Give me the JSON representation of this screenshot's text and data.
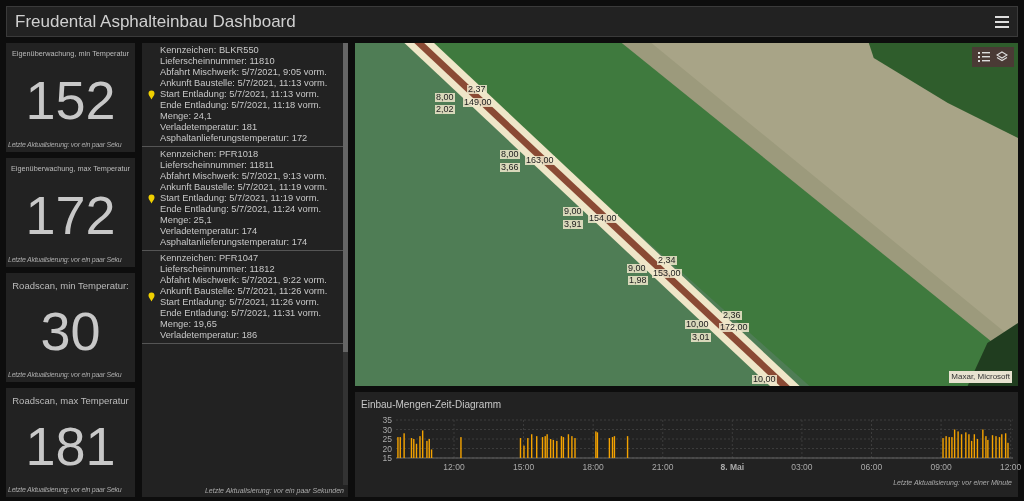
{
  "header": {
    "title": "Freudental Asphalteinbau Dashboard"
  },
  "indicators": [
    {
      "title": "Eigenüberwachung, min Temperatur",
      "value": "152",
      "footer": "Letzte Aktualisierung: vor ein paar Seku"
    },
    {
      "title": "Eigenüberwachung, max Temperatur",
      "value": "172",
      "footer": "Letzte Aktualisierung: vor ein paar Seku"
    },
    {
      "title": "Roadscan, min Temperatur:",
      "value": "30",
      "footer": "Letzte Aktualisierung: vor ein paar Seku"
    },
    {
      "title": "Roadscan, max Temperatur",
      "value": "181",
      "footer": "Letzte Aktualisierung: vor ein paar Seku"
    }
  ],
  "deliveries": {
    "items": [
      {
        "lines": [
          "Kennzeichen: BLKR550",
          "Lieferscheinnummer: 11810",
          "Abfahrt Mischwerk: 5/7/2021, 9:05 vorm.",
          "Ankunft Baustelle: 5/7/2021, 11:13 vorm.",
          "Start Entladung: 5/7/2021, 11:13 vorm.",
          "Ende Entladung: 5/7/2021, 11:18 vorm.",
          "Menge: 24,1",
          "Verladetemperatur: 181",
          "Asphaltanlieferungstemperatur: 172"
        ]
      },
      {
        "lines": [
          "Kennzeichen: PFR1018",
          "Lieferscheinnummer: 11811",
          "Abfahrt Mischwerk: 5/7/2021, 9:13 vorm.",
          "Ankunft Baustelle: 5/7/2021, 11:19 vorm.",
          "Start Entladung: 5/7/2021, 11:19 vorm.",
          "Ende Entladung: 5/7/2021, 11:24 vorm.",
          "Menge: 25,1",
          "Verladetemperatur: 174",
          "Asphaltanlieferungstemperatur: 174"
        ]
      },
      {
        "lines": [
          "Kennzeichen: PFR1047",
          "Lieferscheinnummer: 11812",
          "Abfahrt Mischwerk: 5/7/2021, 9:22 vorm.",
          "Ankunft Baustelle: 5/7/2021, 11:26 vorm.",
          "Start Entladung: 5/7/2021, 11:26 vorm.",
          "Ende Entladung: 5/7/2021, 11:31 vorm.",
          "Menge: 19,65",
          "Verladetemperatur: 186"
        ]
      }
    ],
    "footer": "Letzte Aktualisierung: vor ein paar Sekunden"
  },
  "map": {
    "labels": [
      "2,37",
      "8,00",
      "149,00",
      "2,02",
      "8,00",
      "163,00",
      "3,66",
      "9,00",
      "154,00",
      "3,91",
      "2,34",
      "9,00",
      "153,00",
      "1,98",
      "2,36",
      "10,00",
      "172,00",
      "3,01",
      "10,00"
    ],
    "attribution": "Maxar, Microsoft"
  },
  "chart": {
    "title": "Einbau-Mengen-Zeit-Diagramm",
    "footer": "Letzte Aktualisierung: vor einer Minute",
    "chart_data": {
      "type": "bar",
      "grid": true,
      "xlim": [
        "2021-05-07T09:30",
        "2021-05-08T12:06"
      ],
      "ylim": [
        15,
        35
      ],
      "yticks": [
        15,
        20,
        25,
        30,
        35
      ],
      "xticks": [
        {
          "value": "2021-05-07T12:00",
          "label": "12:00"
        },
        {
          "value": "2021-05-07T15:00",
          "label": "15:00"
        },
        {
          "value": "2021-05-07T18:00",
          "label": "18:00"
        },
        {
          "value": "2021-05-07T21:00",
          "label": "21:00"
        },
        {
          "value": "2021-05-08T00:00",
          "label": "8. Mai"
        },
        {
          "value": "2021-05-08T03:00",
          "label": "03:00"
        },
        {
          "value": "2021-05-08T06:00",
          "label": "06:00"
        },
        {
          "value": "2021-05-08T09:00",
          "label": "09:00"
        },
        {
          "value": "2021-05-08T12:00",
          "label": "12:00"
        }
      ],
      "x": [
        "2021-05-07T09:35",
        "2021-05-07T09:41",
        "2021-05-07T09:51",
        "2021-05-07T10:10",
        "2021-05-07T10:16",
        "2021-05-07T10:23",
        "2021-05-07T10:32",
        "2021-05-07T10:39",
        "2021-05-07T10:50",
        "2021-05-07T10:56",
        "2021-05-07T11:02",
        "2021-05-07T12:18",
        "2021-05-07T14:52",
        "2021-05-07T15:01",
        "2021-05-07T15:11",
        "2021-05-07T15:21",
        "2021-05-07T15:34",
        "2021-05-07T15:49",
        "2021-05-07T15:56",
        "2021-05-07T16:01",
        "2021-05-07T16:10",
        "2021-05-07T16:17",
        "2021-05-07T16:26",
        "2021-05-07T16:38",
        "2021-05-07T16:43",
        "2021-05-07T16:56",
        "2021-05-07T17:05",
        "2021-05-07T17:13",
        "2021-05-07T18:07",
        "2021-05-07T18:11",
        "2021-05-07T18:42",
        "2021-05-07T18:50",
        "2021-05-07T18:55",
        "2021-05-07T19:29",
        "2021-05-08T09:05",
        "2021-05-08T09:13",
        "2021-05-08T09:21",
        "2021-05-08T09:28",
        "2021-05-08T09:35",
        "2021-05-08T09:44",
        "2021-05-08T09:53",
        "2021-05-08T10:04",
        "2021-05-08T10:12",
        "2021-05-08T10:19",
        "2021-05-08T10:26",
        "2021-05-08T10:34",
        "2021-05-08T10:48",
        "2021-05-08T10:56",
        "2021-05-08T11:01",
        "2021-05-08T11:13",
        "2021-05-08T11:22",
        "2021-05-08T11:31",
        "2021-05-08T11:37",
        "2021-05-08T11:47",
        "2021-05-08T11:53"
      ],
      "series": [
        {
          "color": "#f5a300",
          "values": [
            26,
            26,
            28,
            25.5,
            25,
            22.5,
            26.5,
            29.5,
            24,
            25,
            19.5,
            26,
            25.5,
            21.5,
            25.5,
            27.5,
            26.5,
            26,
            26.5,
            27.5,
            25,
            24.5,
            24,
            26.5,
            26,
            27.5,
            26.5,
            25.5,
            29,
            28.5,
            25.5,
            26,
            26.5,
            26.5,
            25.5,
            26.5,
            26,
            26,
            30,
            29,
            27.5,
            28.5,
            27.5,
            24,
            27.5,
            25,
            30,
            26.5,
            24.5,
            27,
            26.5,
            26,
            27.5,
            28,
            23
          ]
        }
      ]
    }
  }
}
